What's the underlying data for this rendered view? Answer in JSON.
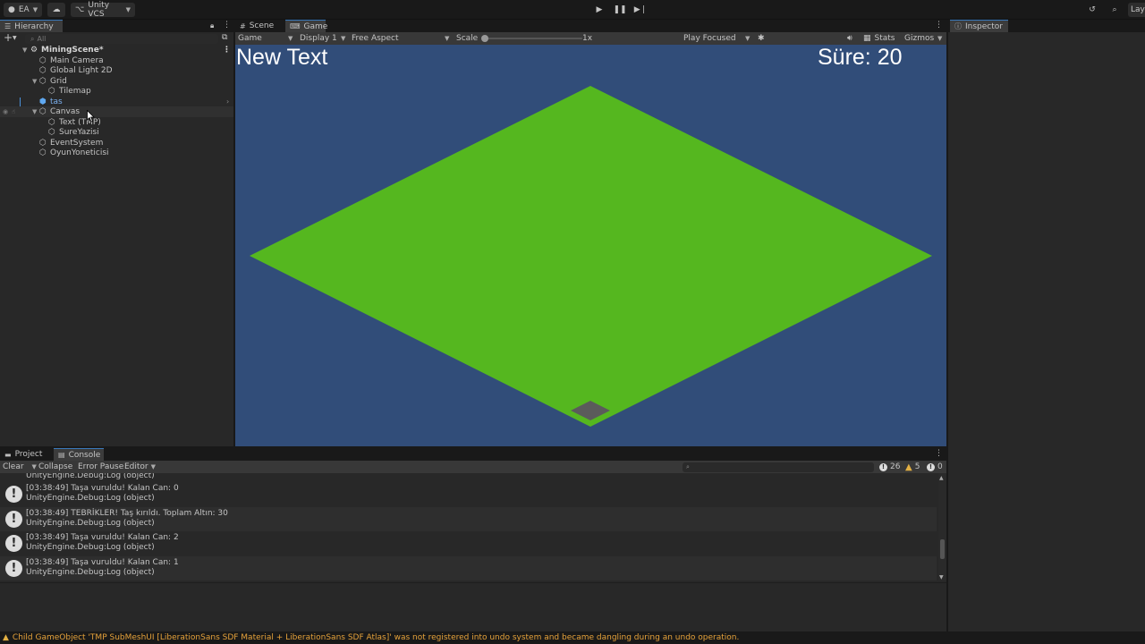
{
  "toolbar": {
    "account_label": "EA",
    "vcs_label": "Unity VCS",
    "layout_label": "Lay"
  },
  "hierarchy": {
    "tab_label": "Hierarchy",
    "search_placeholder": "All",
    "scene_name": "MiningScene*",
    "items": [
      {
        "label": "Main Camera"
      },
      {
        "label": "Global Light 2D"
      },
      {
        "label": "Grid"
      },
      {
        "label": "Tilemap"
      },
      {
        "label": "tas"
      },
      {
        "label": "Canvas"
      },
      {
        "label": "Text (TMP)"
      },
      {
        "label": "SureYazisi"
      },
      {
        "label": "EventSystem"
      },
      {
        "label": "OyunYoneticisi"
      }
    ]
  },
  "gameview": {
    "tab_scene": "Scene",
    "tab_game": "Game",
    "mode": "Game",
    "display": "Display 1",
    "aspect": "Free Aspect",
    "scale_label": "Scale",
    "scale_value": "1x",
    "play_focus": "Play Focused",
    "stats": "Stats",
    "gizmos": "Gizmos",
    "text_left": "New Text",
    "text_right": "Süre: 20",
    "colors": {
      "background": "#314d79",
      "ground": "#55b71f",
      "stone": "#5b5b5b"
    }
  },
  "inspector": {
    "tab_label": "Inspector"
  },
  "console": {
    "tab_project": "Project",
    "tab_console": "Console",
    "clear": "Clear",
    "collapse": "Collapse",
    "error_pause": "Error Pause",
    "editor": "Editor",
    "count_info": "26",
    "count_warn": "5",
    "count_error": "0",
    "partial_line": "UnityEngine.Debug:Log (object)",
    "logs": [
      {
        "line1": "[03:38:49] Taşa vuruldu! Kalan Can: 0",
        "line2": "UnityEngine.Debug:Log (object)"
      },
      {
        "line1": "[03:38:49] TEBRİKLER! Taş kırıldı. Toplam Altın: 30",
        "line2": "UnityEngine.Debug:Log (object)"
      },
      {
        "line1": "[03:38:49] Taşa vuruldu! Kalan Can: 2",
        "line2": "UnityEngine.Debug:Log (object)"
      },
      {
        "line1": "[03:38:49] Taşa vuruldu! Kalan Can: 1",
        "line2": "UnityEngine.Debug:Log (object)"
      }
    ]
  },
  "status": {
    "message": "Child GameObject 'TMP SubMeshUI [LiberationSans SDF Material + LiberationSans SDF Atlas]' was not registered into undo system and became dangling during an undo operation."
  }
}
